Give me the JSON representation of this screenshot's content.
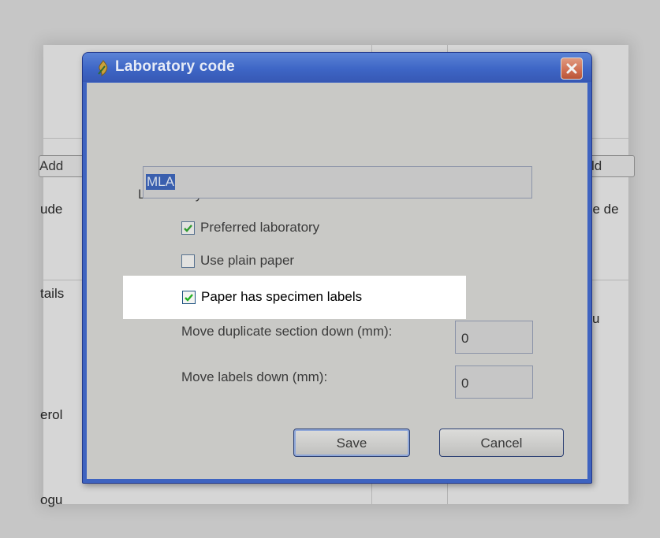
{
  "background": {
    "fragments": {
      "add_left": "Add",
      "add_right": "ld",
      "include_left": "ude",
      "include_right": "de de",
      "details": "tails",
      "cholesterol": "erol",
      "bottom": "ogu",
      "right_marker": "u"
    }
  },
  "dialog": {
    "title": "Laboratory code",
    "icons": {
      "app": "flame-app-icon",
      "close": "close-x-icon"
    },
    "code_label": "Laboratory code:",
    "code_value": "MLA",
    "preferred": {
      "label": "Preferred laboratory",
      "checked": true
    },
    "plain_paper": {
      "label": "Use plain paper",
      "checked": false
    },
    "specimen_labels": {
      "label": "Paper has specimen labels",
      "checked": true
    },
    "duplicate_down": {
      "label": "Move duplicate section down (mm):",
      "value": "0"
    },
    "labels_down": {
      "label": "Move labels down (mm):",
      "value": "0"
    },
    "save_label": "Save",
    "cancel_label": "Cancel"
  }
}
